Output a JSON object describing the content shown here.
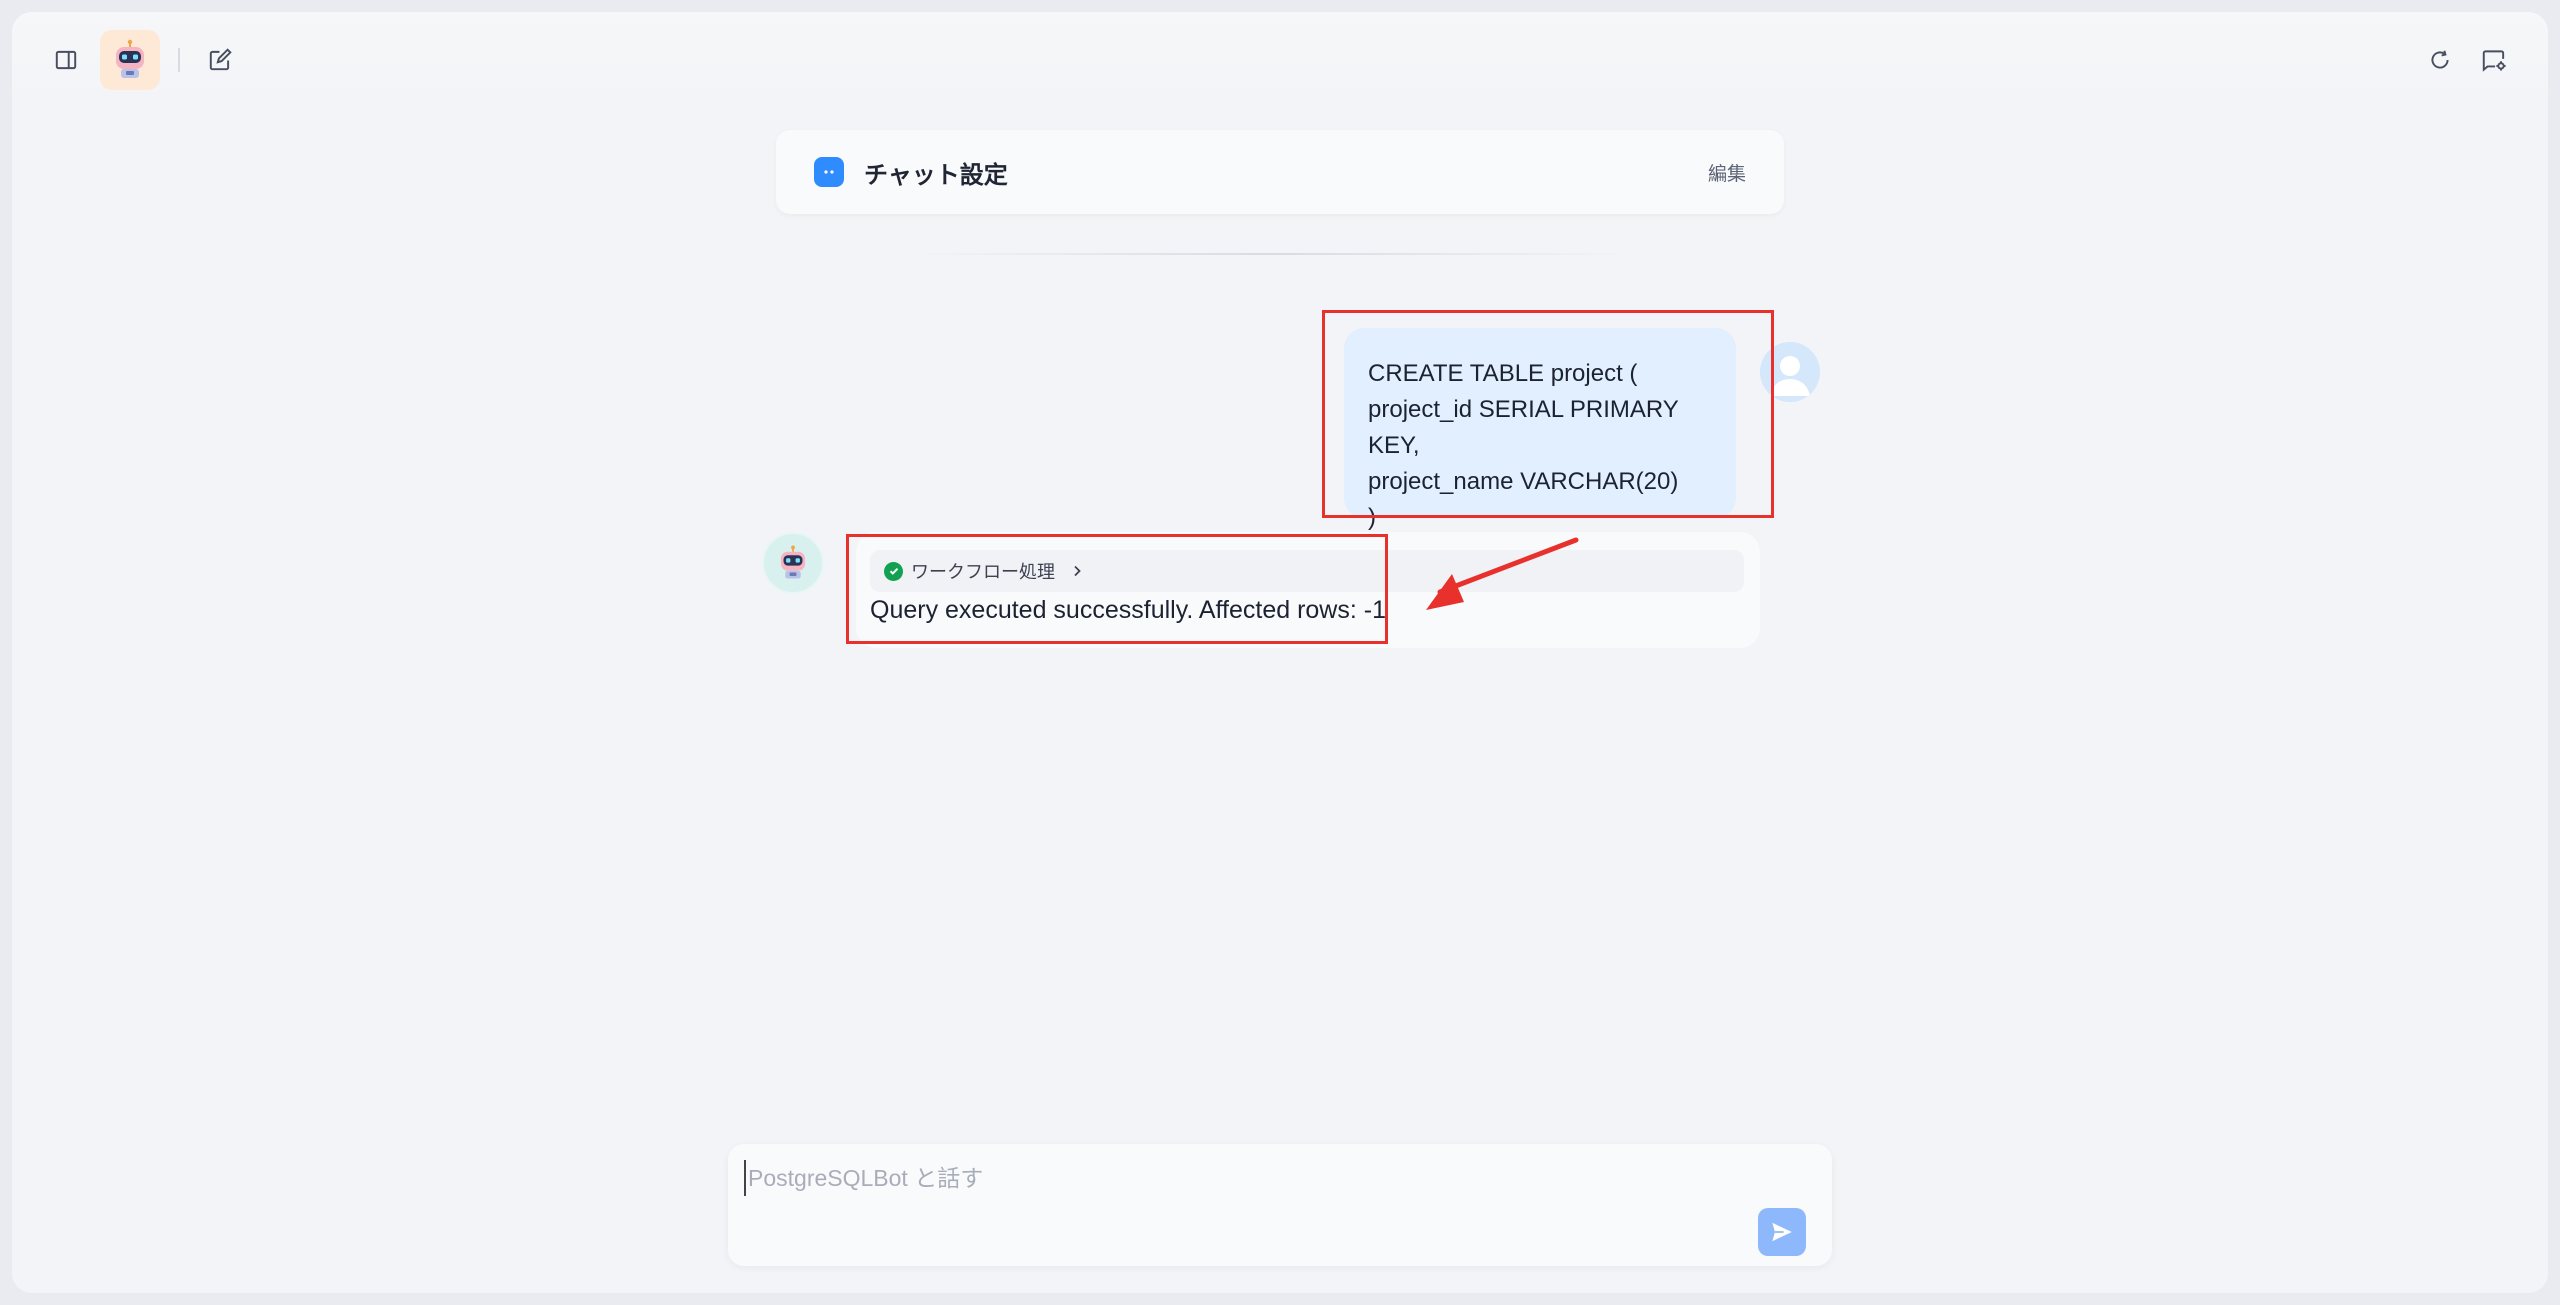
{
  "header": {
    "sidebar_toggle_icon": "sidebar-panel-icon",
    "new_chat_icon": "edit-square-icon",
    "restart_icon": "refresh-icon",
    "settings_icon": "chat-settings-icon"
  },
  "chat_settings": {
    "title": "チャット設定",
    "edit_label": "編集"
  },
  "messages": {
    "user": {
      "lines": [
        "CREATE TABLE project (",
        "project_id SERIAL PRIMARY KEY,",
        "project_name VARCHAR(20)",
        ")"
      ]
    },
    "bot": {
      "workflow_label": "ワークフロー処理",
      "workflow_status": "success",
      "text": "Query executed successfully. Affected rows: -1"
    }
  },
  "composer": {
    "placeholder": "PostgreSQLBot と話す",
    "value": ""
  },
  "colors": {
    "annotation_red": "#e8312c",
    "user_bubble": "#e1efff",
    "accent_blue": "#2f8cff",
    "send_button": "#8db8fb",
    "success_green": "#12a150"
  }
}
